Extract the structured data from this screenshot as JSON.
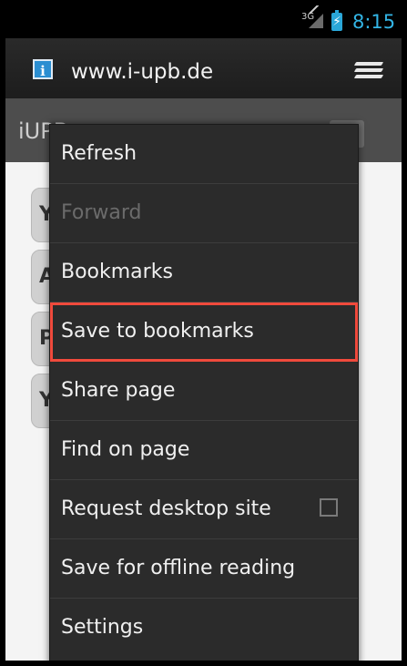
{
  "status_bar": {
    "network": "3G",
    "time": "8:15"
  },
  "browser": {
    "url": "www.i-upb.de",
    "info_icon": "i"
  },
  "site": {
    "title": "iUPB",
    "app_icon_glyphs": [
      "Y",
      "A",
      "P",
      "Y"
    ]
  },
  "menu": {
    "items": [
      {
        "label": "Refresh",
        "enabled": true
      },
      {
        "label": "Forward",
        "enabled": false
      },
      {
        "label": "Bookmarks",
        "enabled": true
      },
      {
        "label": "Save to bookmarks",
        "enabled": true,
        "highlighted": true
      },
      {
        "label": "Share page",
        "enabled": true
      },
      {
        "label": "Find on page",
        "enabled": true
      },
      {
        "label": "Request desktop site",
        "enabled": true,
        "checkbox": false
      },
      {
        "label": "Save for offline reading",
        "enabled": true
      },
      {
        "label": "Settings",
        "enabled": true
      }
    ]
  },
  "colors": {
    "accent": "#33b5e5",
    "highlight": "#f04a3c",
    "menu_bg": "#2b2b2b"
  }
}
